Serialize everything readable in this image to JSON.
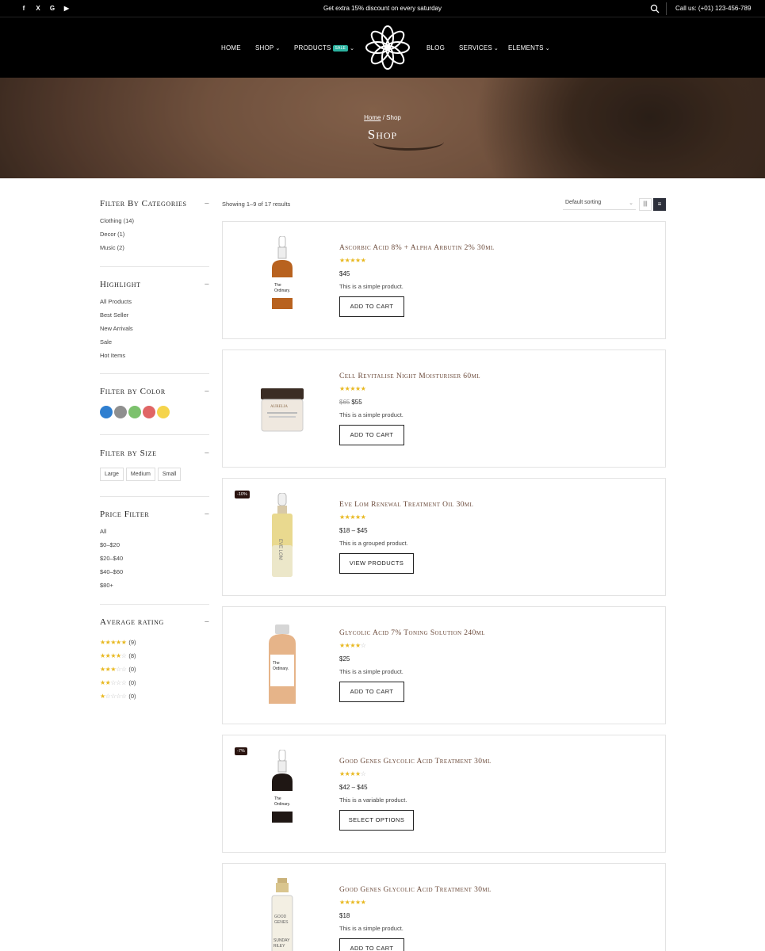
{
  "topbar": {
    "social": [
      {
        "icon": "facebook-icon",
        "glyph": "f"
      },
      {
        "icon": "x-icon",
        "glyph": "X"
      },
      {
        "icon": "google-icon",
        "glyph": "G"
      },
      {
        "icon": "youtube-icon",
        "glyph": "▶"
      }
    ],
    "promo": "Get extra 15% discount on every saturday",
    "call": "Call us: (+01) 123-456-789"
  },
  "nav": {
    "home": "HOME",
    "shop": "SHOP",
    "products": "PRODUCTS",
    "sale_badge": "SALE",
    "blog": "BLOG",
    "services": "SERVICES",
    "elements": "ELEMENTS"
  },
  "hero": {
    "crumb_home": "Home",
    "crumb_sep": " / ",
    "crumb_current": "Shop",
    "title": "Shop"
  },
  "sidebar": {
    "categories": {
      "title": "Filter By Categories",
      "items": [
        "Clothing (14)",
        "Decor (1)",
        "Music (2)"
      ]
    },
    "highlight": {
      "title": "Highlight",
      "items": [
        "All Products",
        "Best Seller",
        "New Arrivals",
        "Sale",
        "Hot Items"
      ]
    },
    "color": {
      "title": "Filter by Color",
      "swatches": [
        "#2f7fd0",
        "#8f8f8f",
        "#7cc16d",
        "#e06565",
        "#f5d44b"
      ]
    },
    "size": {
      "title": "Filter by Size",
      "items": [
        "Large",
        "Medium",
        "Small"
      ]
    },
    "price": {
      "title": "Price Filter",
      "items": [
        "All",
        "$0–$20",
        "$20–$40",
        "$40–$60",
        "$80+"
      ]
    },
    "rating": {
      "title": "Average rating",
      "rows": [
        {
          "stars": 5,
          "count": "(9)"
        },
        {
          "stars": 4,
          "count": "(8)"
        },
        {
          "stars": 3,
          "count": "(0)"
        },
        {
          "stars": 2,
          "count": "(0)"
        },
        {
          "stars": 1,
          "count": "(0)"
        }
      ]
    }
  },
  "toolbar": {
    "result_count": "Showing 1–9 of 17 results",
    "sorting": "Default sorting"
  },
  "products": [
    {
      "name": "Ascorbic Acid 8% + Alpha Arbutin 2% 30ml",
      "stars": 5,
      "old_price": "",
      "price": "$45",
      "desc": "This is a simple product.",
      "cta": "ADD TO CART",
      "badge": "",
      "img": "dropper-amber"
    },
    {
      "name": "Cell Revitalise Night Moisturiser 60ml",
      "stars": 5,
      "old_price": "$65",
      "price": "$55",
      "desc": "This is a simple product.",
      "cta": "ADD TO CART",
      "badge": "",
      "img": "jar"
    },
    {
      "name": "Eve Lom Renewal Treatment Oil 30ml",
      "stars": 5,
      "old_price": "",
      "price": "$18 – $45",
      "desc": "This is a grouped product.",
      "cta": "VIEW PRODUCTS",
      "badge": "-10%",
      "img": "oil-bottle"
    },
    {
      "name": "Glycolic Acid 7% Toning Solution 240ml",
      "stars": 4,
      "old_price": "",
      "price": "$25",
      "desc": "This is a simple product.",
      "cta": "ADD TO CART",
      "badge": "",
      "img": "toner-bottle"
    },
    {
      "name": "Good Genes Glycolic Acid Treatment 30ml",
      "stars": 4,
      "old_price": "",
      "price": "$42 – $45",
      "desc": "This is a variable product.",
      "cta": "SELECT OPTIONS",
      "badge": "-7%",
      "img": "dropper-dark"
    },
    {
      "name": "Good Genes Glycolic Acid Treatment 30ml",
      "stars": 5,
      "old_price": "",
      "price": "$18",
      "desc": "This is a simple product.",
      "cta": "ADD TO CART",
      "badge": "",
      "img": "pump-bottle"
    }
  ]
}
